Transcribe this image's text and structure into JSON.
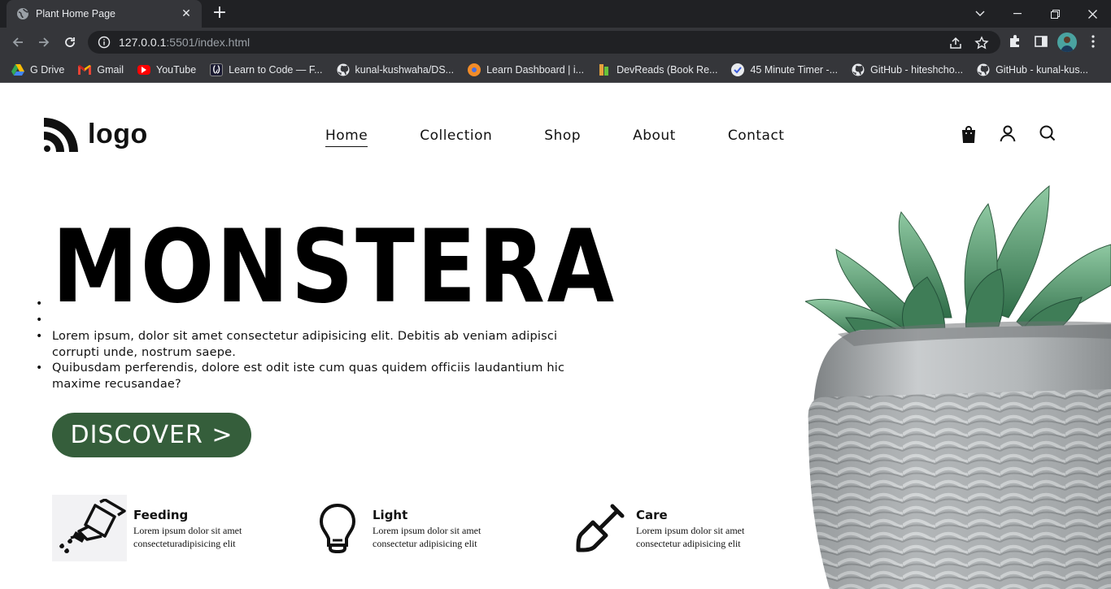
{
  "browser": {
    "tab_title": "Plant Home Page",
    "tab_close": "✕",
    "new_tab": "+",
    "url_host": "127.0.0.1",
    "url_path": ":5501/index.html",
    "bookmarks": [
      {
        "label": "G Drive",
        "icon": "google-drive-icon"
      },
      {
        "label": "Gmail",
        "icon": "gmail-icon"
      },
      {
        "label": "YouTube",
        "icon": "youtube-icon"
      },
      {
        "label": "Learn to Code — F...",
        "icon": "freecodecamp-icon"
      },
      {
        "label": "kunal-kushwaha/DS...",
        "icon": "github-icon"
      },
      {
        "label": "Learn Dashboard | i...",
        "icon": "ineuron-icon"
      },
      {
        "label": "DevReads (Book Re...",
        "icon": "devreads-icon"
      },
      {
        "label": "45 Minute Timer -...",
        "icon": "timer-icon"
      },
      {
        "label": "GitHub - hiteshcho...",
        "icon": "github-icon"
      },
      {
        "label": "GitHub - kunal-kus...",
        "icon": "github-icon"
      }
    ]
  },
  "header": {
    "logo_text": "logo",
    "nav": [
      "Home",
      "Collection",
      "Shop",
      "About",
      "Contact"
    ],
    "icons": [
      "shopping-bag-icon",
      "user-icon",
      "search-icon"
    ]
  },
  "hero": {
    "title": "MONSTERA",
    "bullets": [
      "",
      "",
      "Lorem ipsum, dolor sit amet consectetur adipisicing elit. Debitis ab veniam adipisci corrupti unde, nostrum saepe.",
      "Quibusdam perferendis, dolore est odit iste cum quas quidem officiis laudantium hic maxime recusandae?"
    ],
    "cta": "DISCOVER >"
  },
  "features": [
    {
      "name": "Feeding",
      "desc": "Lorem ipsum dolor sit amet consecteturadipisicing elit",
      "icon": "watering-can-icon"
    },
    {
      "name": "Light",
      "desc": "Lorem ipsum dolor sit amet consectetur adipisicing elit",
      "icon": "light-bulb-icon"
    },
    {
      "name": "Care",
      "desc": "Lorem ipsum dolor sit amet consectetur adipisicing elit",
      "icon": "shovel-icon"
    }
  ],
  "colors": {
    "accent_green": "#355e3b",
    "chrome_dark": "#202124",
    "chrome_mid": "#35363a"
  }
}
